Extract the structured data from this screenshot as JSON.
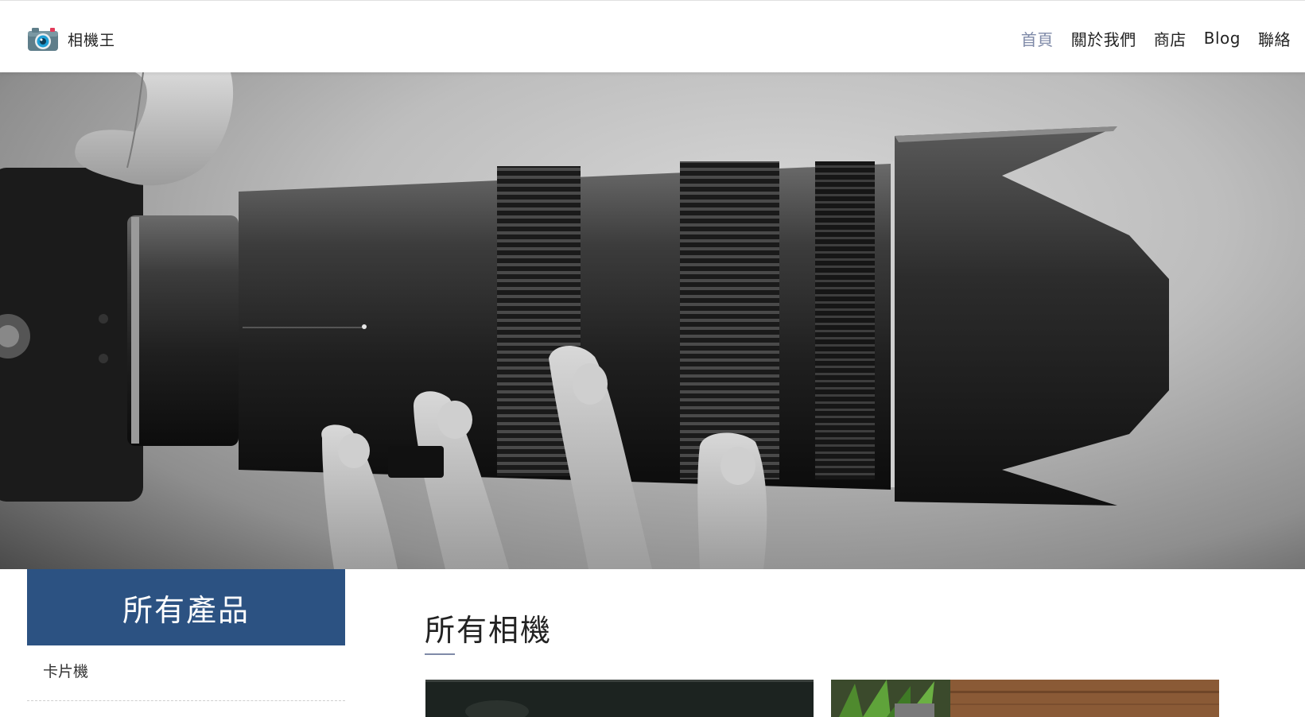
{
  "header": {
    "brand": {
      "name": "相機王",
      "icon": "camera-icon"
    },
    "nav": [
      {
        "label": "首頁",
        "active": true
      },
      {
        "label": "關於我們",
        "active": false
      },
      {
        "label": "商店",
        "active": false
      },
      {
        "label": "Blog",
        "active": false
      },
      {
        "label": "聯絡",
        "active": false
      }
    ]
  },
  "hero": {
    "image": "camera-lens-photo"
  },
  "sidebar": {
    "title": "所有產品",
    "items": [
      {
        "label": "卡片機"
      }
    ]
  },
  "main": {
    "title": "所有相機",
    "cards": [
      {
        "image": "camera-product-photo-dark"
      },
      {
        "image": "camera-product-photo-plant-wood"
      }
    ]
  },
  "colors": {
    "accent": "#2c5282",
    "nav_active": "#7f8aa8",
    "text": "#222222"
  }
}
